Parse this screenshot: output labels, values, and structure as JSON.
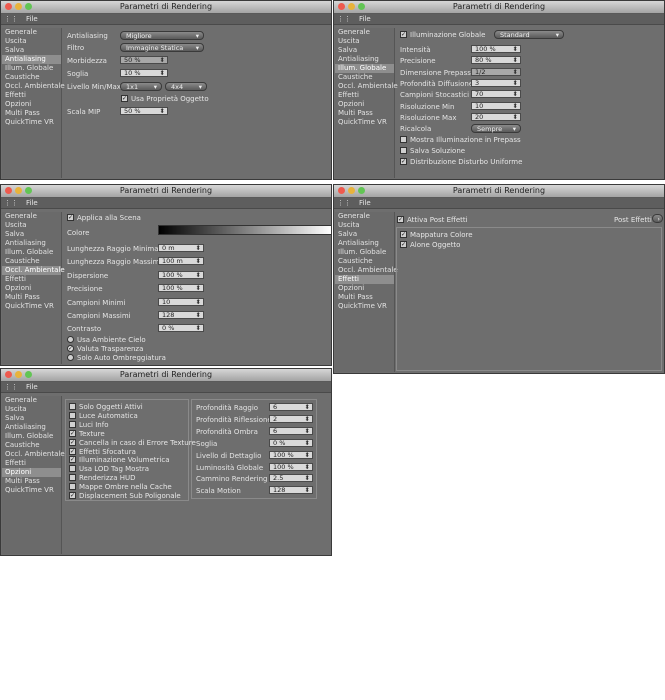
{
  "common": {
    "file_menu": "File",
    "window_title": "Parametri di Rendering"
  },
  "colors": {
    "close": "#ee5a4e",
    "minimize": "#e8b33c",
    "zoom": "#62c554"
  },
  "w1": {
    "sidebar": [
      "Generale",
      "Uscita",
      "Salva",
      "Antialiasing",
      "Illum. Globale",
      "Caustiche",
      "Occl. Ambientale",
      "Effetti",
      "Opzioni",
      "Multi Pass",
      "QuickTime VR"
    ],
    "selected": 3,
    "labels": {
      "antialiasing": "Antialiasing",
      "filtro": "Filtro",
      "morbidezza": "Morbidezza",
      "soglia": "Soglia",
      "livello": "Livello Min/Max",
      "proprieta": "Usa Proprietà Oggetto",
      "scala": "Scala MIP"
    },
    "values": {
      "antialiasing": "Migliore",
      "filtro": "Immagine Statica",
      "morbidezza": "50 %",
      "soglia": "10 %",
      "livello_min": "1x1",
      "livello_max": "4x4",
      "scala": "50 %"
    }
  },
  "w2": {
    "sidebar": [
      "Generale",
      "Uscita",
      "Salva",
      "Antialiasing",
      "Illum. Globale",
      "Caustiche",
      "Occl. Ambientale",
      "Effetti",
      "Opzioni",
      "Multi Pass",
      "QuickTime VR"
    ],
    "selected": 4,
    "ig_label": "Illuminazione Globale",
    "ig_mode": "Standard",
    "rows": [
      {
        "label": "Intensità",
        "value": "100 %"
      },
      {
        "label": "Precisione",
        "value": "80 %"
      },
      {
        "label": "Dimensione Prepass",
        "value": "1/2"
      },
      {
        "label": "Profondità Diffusione",
        "value": "3"
      },
      {
        "label": "Campioni Stocastici",
        "value": "70"
      },
      {
        "label": "Risoluzione Min",
        "value": "10"
      },
      {
        "label": "Risoluzione Max",
        "value": "20"
      },
      {
        "label": "Ricalcola",
        "value": "Sempre"
      }
    ],
    "checks": [
      {
        "label": "Mostra Illuminazione in Prepass",
        "checked": false
      },
      {
        "label": "Salva Soluzione",
        "checked": false
      },
      {
        "label": "Distribuzione Disturbo Uniforme",
        "checked": true
      }
    ]
  },
  "w3": {
    "sidebar": [
      "Generale",
      "Uscita",
      "Salva",
      "Antialiasing",
      "Illum. Globale",
      "Caustiche",
      "Occl. Ambientale",
      "Effetti",
      "Opzioni",
      "Multi Pass",
      "QuickTime VR"
    ],
    "selected": 6,
    "apply": "Applica alla Scena",
    "colore": "Colore",
    "rows": [
      {
        "label": "Lunghezza Raggio Minima",
        "value": "0 m"
      },
      {
        "label": "Lunghezza Raggio Massima",
        "value": "100 m"
      },
      {
        "label": "Dispersione",
        "value": "100 %"
      },
      {
        "label": "Precisione",
        "value": "100 %"
      },
      {
        "label": "Campioni Minimi",
        "value": "10"
      },
      {
        "label": "Campioni Massimi",
        "value": "128"
      },
      {
        "label": "Contrasto",
        "value": "0 %"
      }
    ],
    "checks": [
      {
        "label": "Usa Ambiente Cielo",
        "checked": false
      },
      {
        "label": "Valuta Trasparenza",
        "checked": true
      },
      {
        "label": "Solo Auto Ombreggiatura",
        "checked": false
      }
    ]
  },
  "w4": {
    "sidebar": [
      "Generale",
      "Uscita",
      "Salva",
      "Antialiasing",
      "Illum. Globale",
      "Caustiche",
      "Occl. Ambientale",
      "Effetti",
      "Opzioni",
      "Multi Pass",
      "QuickTime VR"
    ],
    "selected": 7,
    "active": "Attiva Post Effetti",
    "post": "Post Effetti",
    "items": [
      {
        "label": "Mappatura Colore",
        "checked": true
      },
      {
        "label": "Alone Oggetto",
        "checked": true
      }
    ]
  },
  "w5": {
    "sidebar": [
      "Generale",
      "Uscita",
      "Salva",
      "Antialiasing",
      "Illum. Globale",
      "Caustiche",
      "Occl. Ambientale",
      "Effetti",
      "Opzioni",
      "Multi Pass",
      "QuickTime VR"
    ],
    "selected": 8,
    "checks": [
      {
        "label": "Solo Oggetti Attivi",
        "checked": false
      },
      {
        "label": "Luce Automatica",
        "checked": false
      },
      {
        "label": "Luci Info",
        "checked": false
      },
      {
        "label": "Texture",
        "checked": true
      },
      {
        "label": "Cancella in caso di Errore Texture",
        "checked": true
      },
      {
        "label": "Effetti Sfocatura",
        "checked": true
      },
      {
        "label": "Illuminazione Volumetrica",
        "checked": true
      },
      {
        "label": "Usa LOD Tag Mostra",
        "checked": false
      },
      {
        "label": "Renderizza HUD",
        "checked": false
      },
      {
        "label": "Mappe Ombre nella Cache",
        "checked": false
      },
      {
        "label": "Displacement Sub Poligonale",
        "checked": true
      }
    ],
    "rows": [
      {
        "label": "Profondità Raggio",
        "value": "6"
      },
      {
        "label": "Profondità Riflessione",
        "value": "2"
      },
      {
        "label": "Profondità Ombra",
        "value": "6"
      },
      {
        "label": "Soglia",
        "value": "0 %"
      },
      {
        "label": "Livello di Dettaglio",
        "value": "100 %"
      },
      {
        "label": "Luminosità Globale",
        "value": "100 %"
      },
      {
        "label": "Cammino Rendering",
        "value": "2.5"
      },
      {
        "label": "Scala Motion",
        "value": "128"
      }
    ]
  }
}
